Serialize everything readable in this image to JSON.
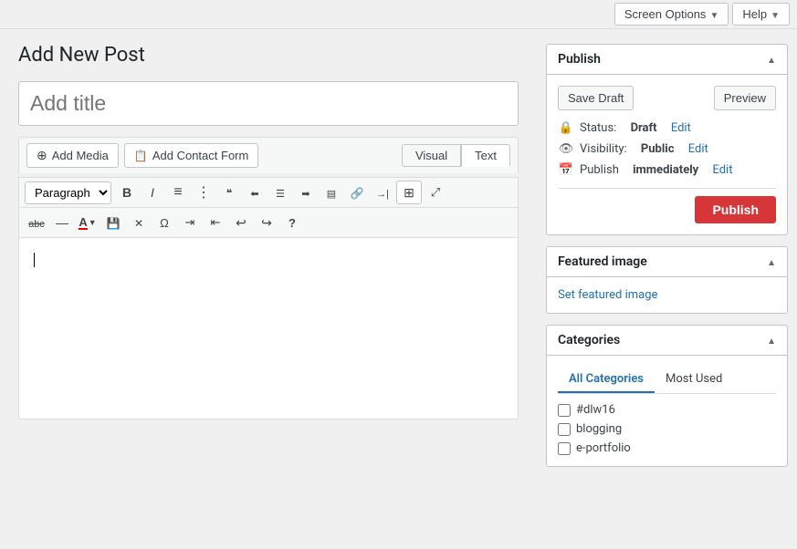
{
  "topbar": {
    "screen_options": "Screen Options",
    "help": "Help"
  },
  "page": {
    "title": "Add New Post"
  },
  "title_input": {
    "placeholder": "Add title"
  },
  "editor": {
    "add_media": "Add Media",
    "add_contact_form": "Add Contact Form",
    "visual_tab": "Visual",
    "text_tab": "Text",
    "paragraph_select": "Paragraph",
    "cursor": ""
  },
  "publish_box": {
    "heading": "Publish",
    "save_draft": "Save Draft",
    "preview": "Preview",
    "status_label": "Status:",
    "status_value": "Draft",
    "status_edit": "Edit",
    "visibility_label": "Visibility:",
    "visibility_value": "Public",
    "visibility_edit": "Edit",
    "publish_label": "Publish",
    "publish_time": "immediately",
    "publish_time_edit": "Edit",
    "publish_button": "Publish"
  },
  "featured_image": {
    "heading": "Featured image",
    "set_link": "Set featured image"
  },
  "categories": {
    "heading": "Categories",
    "tab_all": "All Categories",
    "tab_most_used": "Most Used",
    "items": [
      {
        "label": "#dlw16",
        "checked": false
      },
      {
        "label": "blogging",
        "checked": false
      },
      {
        "label": "e-portfolio",
        "checked": false
      }
    ]
  }
}
